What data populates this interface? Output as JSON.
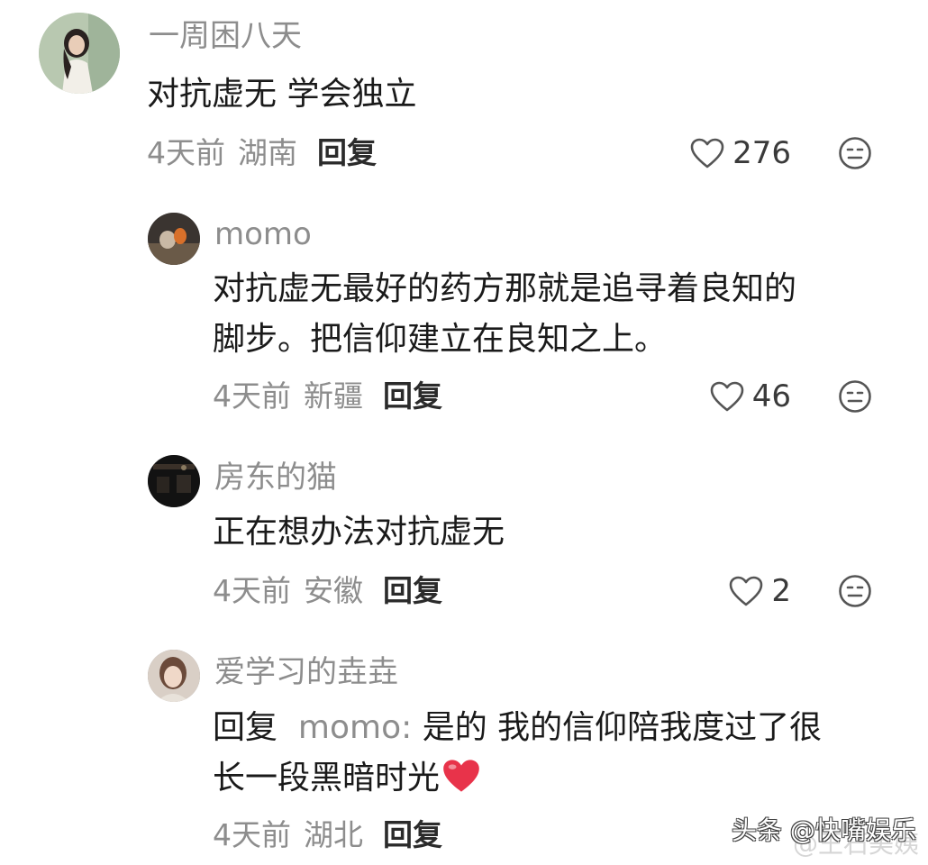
{
  "comments": [
    {
      "username": "一周困八天",
      "text_lines": [
        "对抗虚无 学会独立"
      ],
      "time": "4天前",
      "location": "湖南",
      "reply_label": "回复",
      "likes": "276"
    },
    {
      "username": "momo",
      "text_lines": [
        "对抗虚无最好的药方那就是追寻着良知的",
        "脚步。把信仰建立在良知之上。"
      ],
      "time": "4天前",
      "location": "新疆",
      "reply_label": "回复",
      "likes": "46"
    },
    {
      "username": "房东的猫",
      "text_lines": [
        "正在想办法对抗虚无"
      ],
      "time": "4天前",
      "location": "安徽",
      "reply_label": "回复",
      "likes": "2"
    },
    {
      "username": "爱学习的垚垚",
      "reply_prefix": "回复",
      "reply_to": "momo:",
      "text_line1": "是的 我的信仰陪我度过了很",
      "text_line2": "长一段黑暗时光",
      "time": "4天前",
      "location": "湖北",
      "reply_label": "回复"
    }
  ],
  "icons": {
    "like": "heart-outline-icon",
    "dislike": "meh-face-icon",
    "emoji": "red-heart-emoji"
  },
  "watermark": {
    "toutiao": "头条 @快嘴娱乐",
    "weibo": "@王石美姨"
  },
  "colors": {
    "username": "#8d8d8d",
    "text": "#1a1a1a",
    "reply": "#2b2b2b",
    "heart": "#e8334a"
  }
}
